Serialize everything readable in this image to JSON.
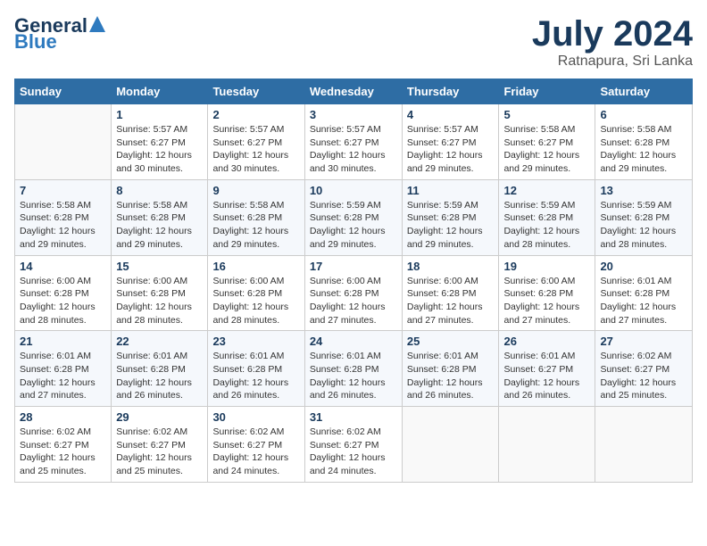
{
  "logo": {
    "general": "General",
    "blue": "Blue"
  },
  "title": "July 2024",
  "location": "Ratnapura, Sri Lanka",
  "days_header": [
    "Sunday",
    "Monday",
    "Tuesday",
    "Wednesday",
    "Thursday",
    "Friday",
    "Saturday"
  ],
  "weeks": [
    [
      {
        "day": "",
        "info": ""
      },
      {
        "day": "1",
        "info": "Sunrise: 5:57 AM\nSunset: 6:27 PM\nDaylight: 12 hours\nand 30 minutes."
      },
      {
        "day": "2",
        "info": "Sunrise: 5:57 AM\nSunset: 6:27 PM\nDaylight: 12 hours\nand 30 minutes."
      },
      {
        "day": "3",
        "info": "Sunrise: 5:57 AM\nSunset: 6:27 PM\nDaylight: 12 hours\nand 30 minutes."
      },
      {
        "day": "4",
        "info": "Sunrise: 5:57 AM\nSunset: 6:27 PM\nDaylight: 12 hours\nand 29 minutes."
      },
      {
        "day": "5",
        "info": "Sunrise: 5:58 AM\nSunset: 6:27 PM\nDaylight: 12 hours\nand 29 minutes."
      },
      {
        "day": "6",
        "info": "Sunrise: 5:58 AM\nSunset: 6:28 PM\nDaylight: 12 hours\nand 29 minutes."
      }
    ],
    [
      {
        "day": "7",
        "info": "Sunrise: 5:58 AM\nSunset: 6:28 PM\nDaylight: 12 hours\nand 29 minutes."
      },
      {
        "day": "8",
        "info": "Sunrise: 5:58 AM\nSunset: 6:28 PM\nDaylight: 12 hours\nand 29 minutes."
      },
      {
        "day": "9",
        "info": "Sunrise: 5:58 AM\nSunset: 6:28 PM\nDaylight: 12 hours\nand 29 minutes."
      },
      {
        "day": "10",
        "info": "Sunrise: 5:59 AM\nSunset: 6:28 PM\nDaylight: 12 hours\nand 29 minutes."
      },
      {
        "day": "11",
        "info": "Sunrise: 5:59 AM\nSunset: 6:28 PM\nDaylight: 12 hours\nand 29 minutes."
      },
      {
        "day": "12",
        "info": "Sunrise: 5:59 AM\nSunset: 6:28 PM\nDaylight: 12 hours\nand 28 minutes."
      },
      {
        "day": "13",
        "info": "Sunrise: 5:59 AM\nSunset: 6:28 PM\nDaylight: 12 hours\nand 28 minutes."
      }
    ],
    [
      {
        "day": "14",
        "info": "Sunrise: 6:00 AM\nSunset: 6:28 PM\nDaylight: 12 hours\nand 28 minutes."
      },
      {
        "day": "15",
        "info": "Sunrise: 6:00 AM\nSunset: 6:28 PM\nDaylight: 12 hours\nand 28 minutes."
      },
      {
        "day": "16",
        "info": "Sunrise: 6:00 AM\nSunset: 6:28 PM\nDaylight: 12 hours\nand 28 minutes."
      },
      {
        "day": "17",
        "info": "Sunrise: 6:00 AM\nSunset: 6:28 PM\nDaylight: 12 hours\nand 27 minutes."
      },
      {
        "day": "18",
        "info": "Sunrise: 6:00 AM\nSunset: 6:28 PM\nDaylight: 12 hours\nand 27 minutes."
      },
      {
        "day": "19",
        "info": "Sunrise: 6:00 AM\nSunset: 6:28 PM\nDaylight: 12 hours\nand 27 minutes."
      },
      {
        "day": "20",
        "info": "Sunrise: 6:01 AM\nSunset: 6:28 PM\nDaylight: 12 hours\nand 27 minutes."
      }
    ],
    [
      {
        "day": "21",
        "info": "Sunrise: 6:01 AM\nSunset: 6:28 PM\nDaylight: 12 hours\nand 27 minutes."
      },
      {
        "day": "22",
        "info": "Sunrise: 6:01 AM\nSunset: 6:28 PM\nDaylight: 12 hours\nand 26 minutes."
      },
      {
        "day": "23",
        "info": "Sunrise: 6:01 AM\nSunset: 6:28 PM\nDaylight: 12 hours\nand 26 minutes."
      },
      {
        "day": "24",
        "info": "Sunrise: 6:01 AM\nSunset: 6:28 PM\nDaylight: 12 hours\nand 26 minutes."
      },
      {
        "day": "25",
        "info": "Sunrise: 6:01 AM\nSunset: 6:28 PM\nDaylight: 12 hours\nand 26 minutes."
      },
      {
        "day": "26",
        "info": "Sunrise: 6:01 AM\nSunset: 6:27 PM\nDaylight: 12 hours\nand 26 minutes."
      },
      {
        "day": "27",
        "info": "Sunrise: 6:02 AM\nSunset: 6:27 PM\nDaylight: 12 hours\nand 25 minutes."
      }
    ],
    [
      {
        "day": "28",
        "info": "Sunrise: 6:02 AM\nSunset: 6:27 PM\nDaylight: 12 hours\nand 25 minutes."
      },
      {
        "day": "29",
        "info": "Sunrise: 6:02 AM\nSunset: 6:27 PM\nDaylight: 12 hours\nand 25 minutes."
      },
      {
        "day": "30",
        "info": "Sunrise: 6:02 AM\nSunset: 6:27 PM\nDaylight: 12 hours\nand 24 minutes."
      },
      {
        "day": "31",
        "info": "Sunrise: 6:02 AM\nSunset: 6:27 PM\nDaylight: 12 hours\nand 24 minutes."
      },
      {
        "day": "",
        "info": ""
      },
      {
        "day": "",
        "info": ""
      },
      {
        "day": "",
        "info": ""
      }
    ]
  ]
}
